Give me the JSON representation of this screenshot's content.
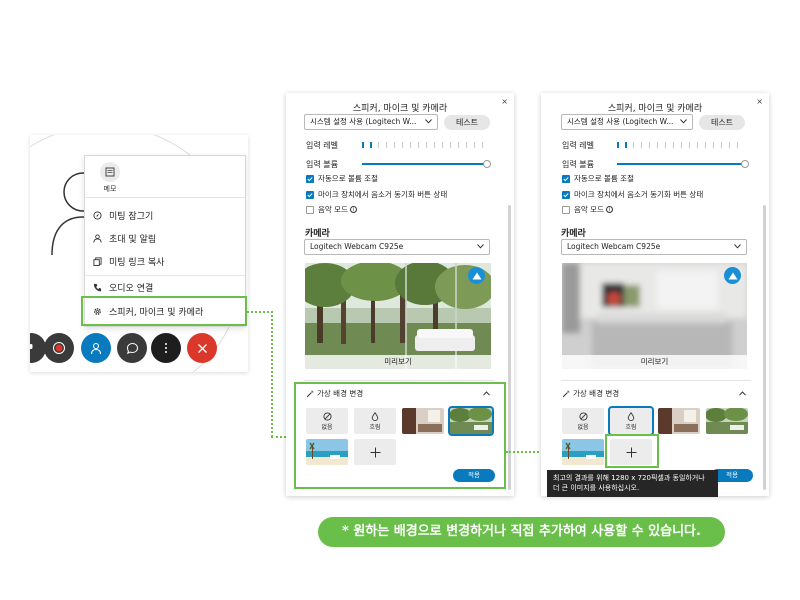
{
  "left": {
    "menu": {
      "memo_label": "메모",
      "items": [
        {
          "label": "미팅 잠그기",
          "icon": "compass-icon"
        },
        {
          "label": "초대 및 알림",
          "icon": "person-icon"
        },
        {
          "label": "미팅 링크 복사",
          "icon": "copy-icon"
        },
        {
          "label": "오디오 연결",
          "icon": "phone-icon"
        },
        {
          "label": "스피커, 마이크 및 카메라",
          "icon": "gear-icon"
        }
      ]
    },
    "controls": [
      "mute-icon",
      "record-icon",
      "participants-icon",
      "chat-icon",
      "more-icon",
      "close-icon"
    ]
  },
  "dialog": {
    "title": "스피커, 마이크 및 카메라",
    "close": "×",
    "speaker_select": "시스템 설정 사용 (Logitech W...",
    "test_button": "테스트",
    "input_level_label": "입력 레벨",
    "input_volume_label": "입력 볼륨",
    "auto_volume": "자동으로 볼륨 조절",
    "sync_mute": "마이크 장치에서 음소거 동기화 버튼 상태",
    "music_mode": "음악 모드",
    "camera_header": "카메라",
    "camera_select": "Logitech Webcam C925e",
    "preview_label": "미리보기",
    "vb_header": "가상 배경 변경",
    "vb_none": "없음",
    "vb_blur": "흐림",
    "apply": "적용",
    "tooltip": "최고의 결과를 위해 1280 x 720픽셀과 동일하거나 더 큰 이미지를 사용하십시오."
  },
  "caption": "* 원하는 배경으로 변경하거나 직접 추가하여 사용할 수 있습니다.",
  "colors": {
    "accent": "#0a7abf",
    "highlight_green": "#6abf4b",
    "end_call_red": "#d9382b"
  }
}
